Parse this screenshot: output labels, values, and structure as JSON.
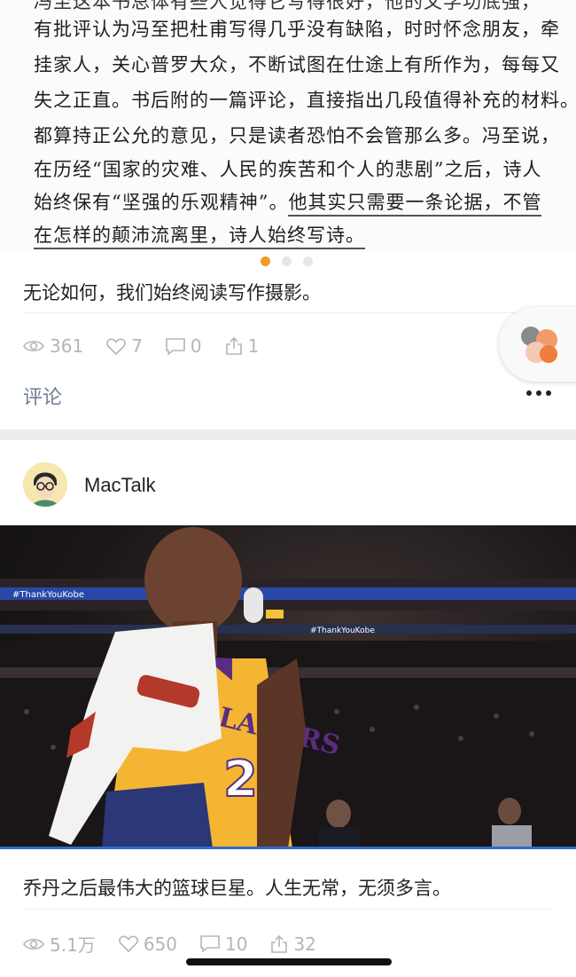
{
  "post1": {
    "image_text": {
      "cut_line": "冯至这本书总体有些人觉得它写得很好，他的文学功底强，",
      "lines": [
        "有批评认为冯至把杜甫写得几乎没有缺陷，时时怀念朋友，牵",
        "挂家人，关心普罗大众，不断试图在仕途上有所作为，每每又",
        "失之正直。书后附的一篇评论，直接指出几段值得补充的材料。",
        "都算持正公允的意见，只是读者恐怕不会管那么多。冯至说，",
        "在历经“国家的灾难、人民的疾苦和个人的悲剧”之后，诗人",
        "始终保有“坚强的乐观精神”。"
      ],
      "underlined_1": "他其实只需要一条论据，不管",
      "underlined_2": "在怎样的颠沛流离里，诗人始终写诗。"
    },
    "caption": "无论如何，我们始终阅读写作摄影。",
    "stats": {
      "views": "361",
      "likes": "7",
      "comments": "0",
      "shares": "1"
    },
    "comment_label": "评论"
  },
  "post2": {
    "author": "MacTalk",
    "caption": "乔丹之后最伟大的篮球巨星。人生无常，无须多言。",
    "stats": {
      "views": "5.1万",
      "likes": "650",
      "comments": "10",
      "shares": "32"
    },
    "photo_texts": {
      "jersey_team": "LAKERS",
      "jersey_number": "24",
      "banner": "#ThankYouKobe"
    }
  },
  "colors": {
    "accent": "#f29b28",
    "link": "#6e7f98",
    "icon_gray": "#b5b5b5"
  },
  "icons": [
    "eye-icon",
    "heart-icon",
    "comment-icon",
    "share-icon",
    "more-icon",
    "avatar"
  ]
}
